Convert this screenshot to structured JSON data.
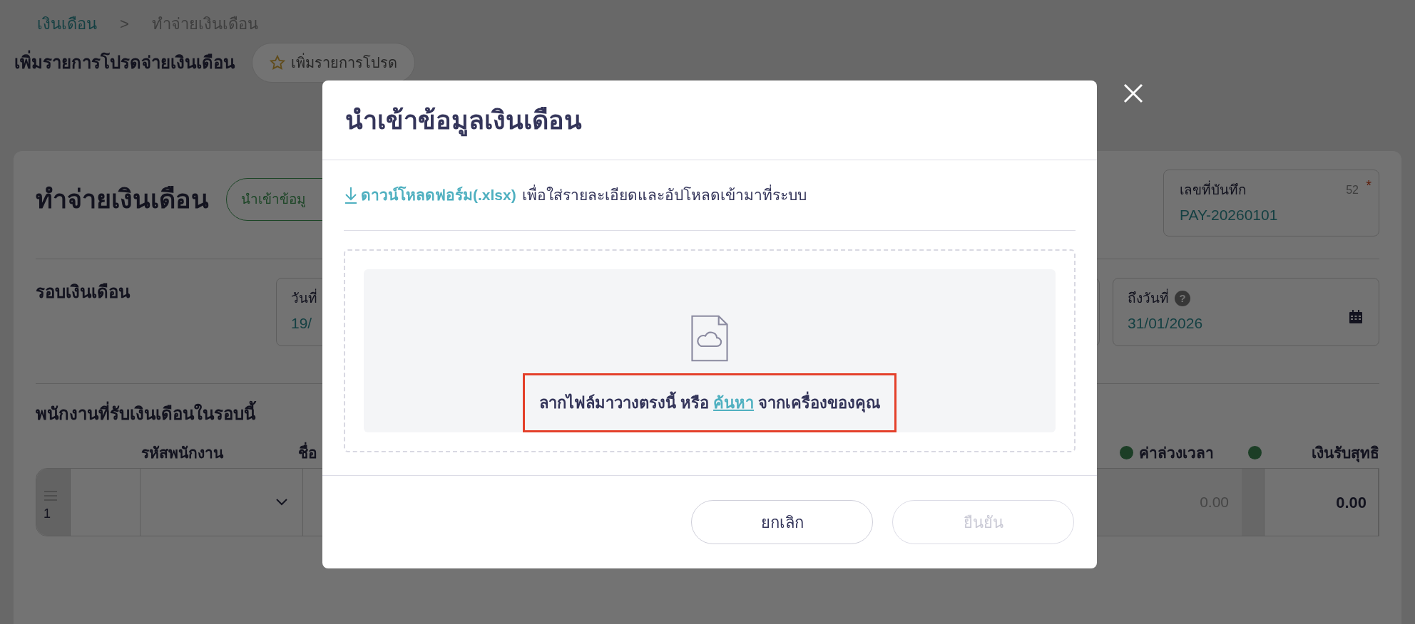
{
  "breadcrumb": [
    {
      "label": "เงินเดือน",
      "kind": "link"
    },
    {
      "label": ">",
      "kind": "separator"
    },
    {
      "label": "ทำจ่ายเงินเดือน",
      "kind": "current"
    }
  ],
  "favorites": {
    "label": "เพิ่มรายการโปรดจ่ายเงินเดือน",
    "button": "เพิ่มรายการโปรด"
  },
  "form": {
    "title": "ทำจ่ายเงินเดือน",
    "import_button": "นำเข้าข้อมู",
    "record_no": {
      "label": "เลขที่บันทึก",
      "count": "52",
      "required_mark": "*",
      "value": "PAY-20260101"
    },
    "period": {
      "label": "รอบเงินเดือน",
      "from": {
        "label": "วันที่",
        "value": "19/"
      },
      "to": {
        "label": "ถึงวันที่",
        "help": "?",
        "value": "31/01/2026"
      }
    },
    "employees": {
      "title": "พนักงานที่รับเงินเดือนในรอบนี้",
      "columns": [
        {
          "label": "รหัสพนักงาน",
          "dot": false
        },
        {
          "label": "ชื่อ",
          "dot": false
        },
        {
          "label": "ค่าล่วงเวลา",
          "dot": true
        },
        {
          "label": "เงินรับสุทธิ",
          "dot": true
        }
      ],
      "rows": [
        {
          "index": "1",
          "overtime": "0.00",
          "net": "0.00"
        }
      ]
    }
  },
  "modal": {
    "title": "นำเข้าข้อมูลเงินเดือน",
    "download_link": "ดาวน์โหลดฟอร์ม(.xlsx)",
    "download_note": "เพื่อใส่รายละเอียดและอัปโหลดเข้ามาที่ระบบ",
    "drop_text": "ลากไฟล์มาวางตรงนี้ หรือ",
    "browse_link": "ค้นหา",
    "drop_suffix": "จากเครื่องของคุณ",
    "highlighted": true,
    "buttons": [
      {
        "label": "ยกเลิก",
        "disabled": false
      },
      {
        "label": "ยืนยัน",
        "disabled": true
      }
    ]
  }
}
